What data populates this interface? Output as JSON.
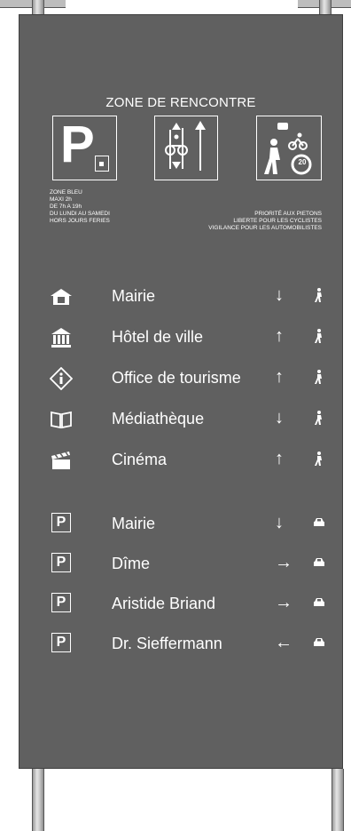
{
  "sign": {
    "zone_title": "ZONE DE RENCONTRE",
    "parking_text": [
      "ZONE BLEU",
      "MAXI 2h",
      "DE 7h A 19h",
      "DU LUNDI AU SAMEDI",
      "HORS JOURS FERIES"
    ],
    "priority_text": [
      "PRIORITÉ AUX PIETONS",
      "LIBERTE POUR LES CYCLISTES",
      "VIGILANCE POUR LES AUTOMOBILISTES"
    ],
    "speed_limit": "20",
    "parking_letter": "P"
  },
  "pedestrian_destinations": [
    {
      "label": "Mairie",
      "arrow": "↓",
      "icon": "town-hall-icon"
    },
    {
      "label": "Hôtel de ville",
      "arrow": "↑",
      "icon": "city-hall-icon"
    },
    {
      "label": "Office de tourisme",
      "arrow": "↑",
      "icon": "info-icon"
    },
    {
      "label": "Médiathèque",
      "arrow": "↓",
      "icon": "book-icon"
    },
    {
      "label": "Cinéma",
      "arrow": "↑",
      "icon": "clapperboard-icon"
    }
  ],
  "parking_destinations": [
    {
      "label": "Mairie",
      "arrow": "↓"
    },
    {
      "label": "Dîme",
      "arrow": "→"
    },
    {
      "label": "Aristide Briand",
      "arrow": "→"
    },
    {
      "label": "Dr. Sieffermann",
      "arrow": "←"
    }
  ],
  "colors": {
    "panel": "#606060",
    "text": "#ffffff",
    "post": "#cfcfcf"
  }
}
